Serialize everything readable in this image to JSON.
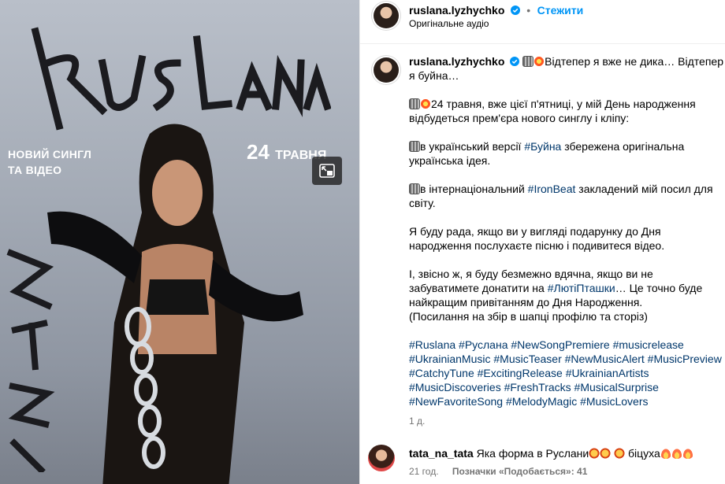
{
  "media": {
    "logo_text": "RUSLANA",
    "subtitle_line1": "НОВИЙ СИНГЛ",
    "subtitle_line2": "ТА ВІДЕО",
    "date_day": "24",
    "date_month": "ТРАВНЯ",
    "side_text": "БУЙНА"
  },
  "header": {
    "username": "ruslana.lyzhychko",
    "follow_label": "Стежити",
    "audio_label": "Оригінальне аудіо"
  },
  "caption": {
    "username": "ruslana.lyzhychko",
    "line1": "Відтепер я вже не дика… Відтепер я буйна…",
    "p2": "24 травня, вже цієї п'ятниці, у мій День народження відбудеться прем'єра нового синглу і кліпу:",
    "p3a": "в український версії ",
    "p3tag": "#Буйна",
    "p3b": " збережена оригінальна українська ідея.",
    "p4a": "в інтернаціональний ",
    "p4tag": "#IronBeat",
    "p4b": " закладений мій посил для світу.",
    "p5": "Я буду рада, якщо ви у вигляді подарунку до Дня народження послухаєте пісню і подивитеся відео.",
    "p6a": "І, звісно ж, я буду безмежно вдячна, якщо ви не забуватимете донатити на ",
    "p6tag": "#ЛютіПташки",
    "p6b": "… Це точно буде найкращим привітанням до Дня Народження.",
    "p6c": "(Посилання на збір в шапці профілю та сторіз)",
    "hashtags": [
      "#Ruslana",
      "#Руслана",
      "#NewSongPremiere",
      "#musicrelease",
      "#UkrainianMusic",
      "#MusicTeaser",
      "#NewMusicAlert",
      "#MusicPreview",
      "#CatchyTune",
      "#ExcitingRelease",
      "#UkrainianArtists",
      "#MusicDiscoveries",
      "#FreshTracks",
      "#MusicalSurprise",
      "#NewFavoriteSong",
      "#MelodyMagic",
      "#MusicLovers"
    ],
    "time": "1 д."
  },
  "comment": {
    "username": "tata_na_tata",
    "text": "Яка форма в Руслани",
    "text_after": " біцуха",
    "time": "21 год.",
    "likes": "Позначки «Подобається»: 41"
  },
  "colors": {
    "accent": "#0095f6",
    "hashtag": "#00376b",
    "muted": "#737373"
  }
}
